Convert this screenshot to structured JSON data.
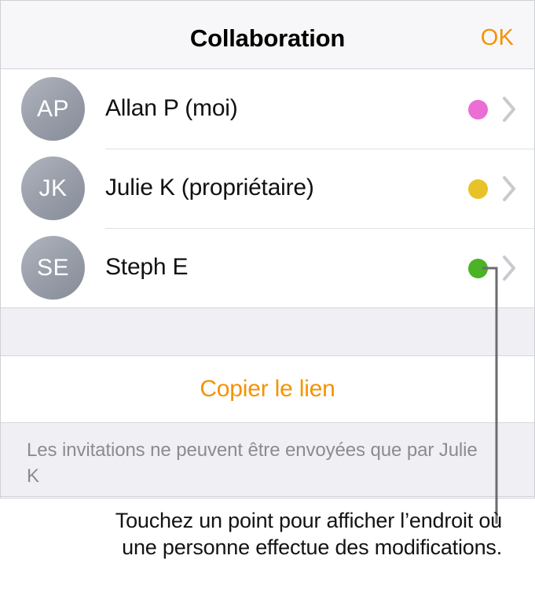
{
  "header": {
    "title": "Collaboration",
    "done_label": "OK",
    "accent_color": "#f59200"
  },
  "people": [
    {
      "initials": "AP",
      "name": "Allan P (moi)",
      "dot_color": "#ea6ed3",
      "chevron": "chevron-right-icon"
    },
    {
      "initials": "JK",
      "name": "Julie K (propriétaire)",
      "dot_color": "#e8c328",
      "chevron": "chevron-right-icon"
    },
    {
      "initials": "SE",
      "name": "Steph E",
      "dot_color": "#4cb226",
      "chevron": "chevron-right-icon"
    }
  ],
  "actions": {
    "copy_link_label": "Copier le lien"
  },
  "footnote": {
    "text": "Les invitations ne peuvent être envoyées que par Julie K"
  },
  "caption": {
    "text": "Touchez un point pour afficher l’endroit où une personne effectue des modifications."
  },
  "colors": {
    "panel_background": "#ffffff",
    "band_background": "#f0eff4",
    "header_background": "#f7f7f9",
    "separator": "#e0e0e4",
    "callout_line": "#6b6b70",
    "chevron": "#c9c9cf",
    "footnote_text": "#8b8b91"
  }
}
